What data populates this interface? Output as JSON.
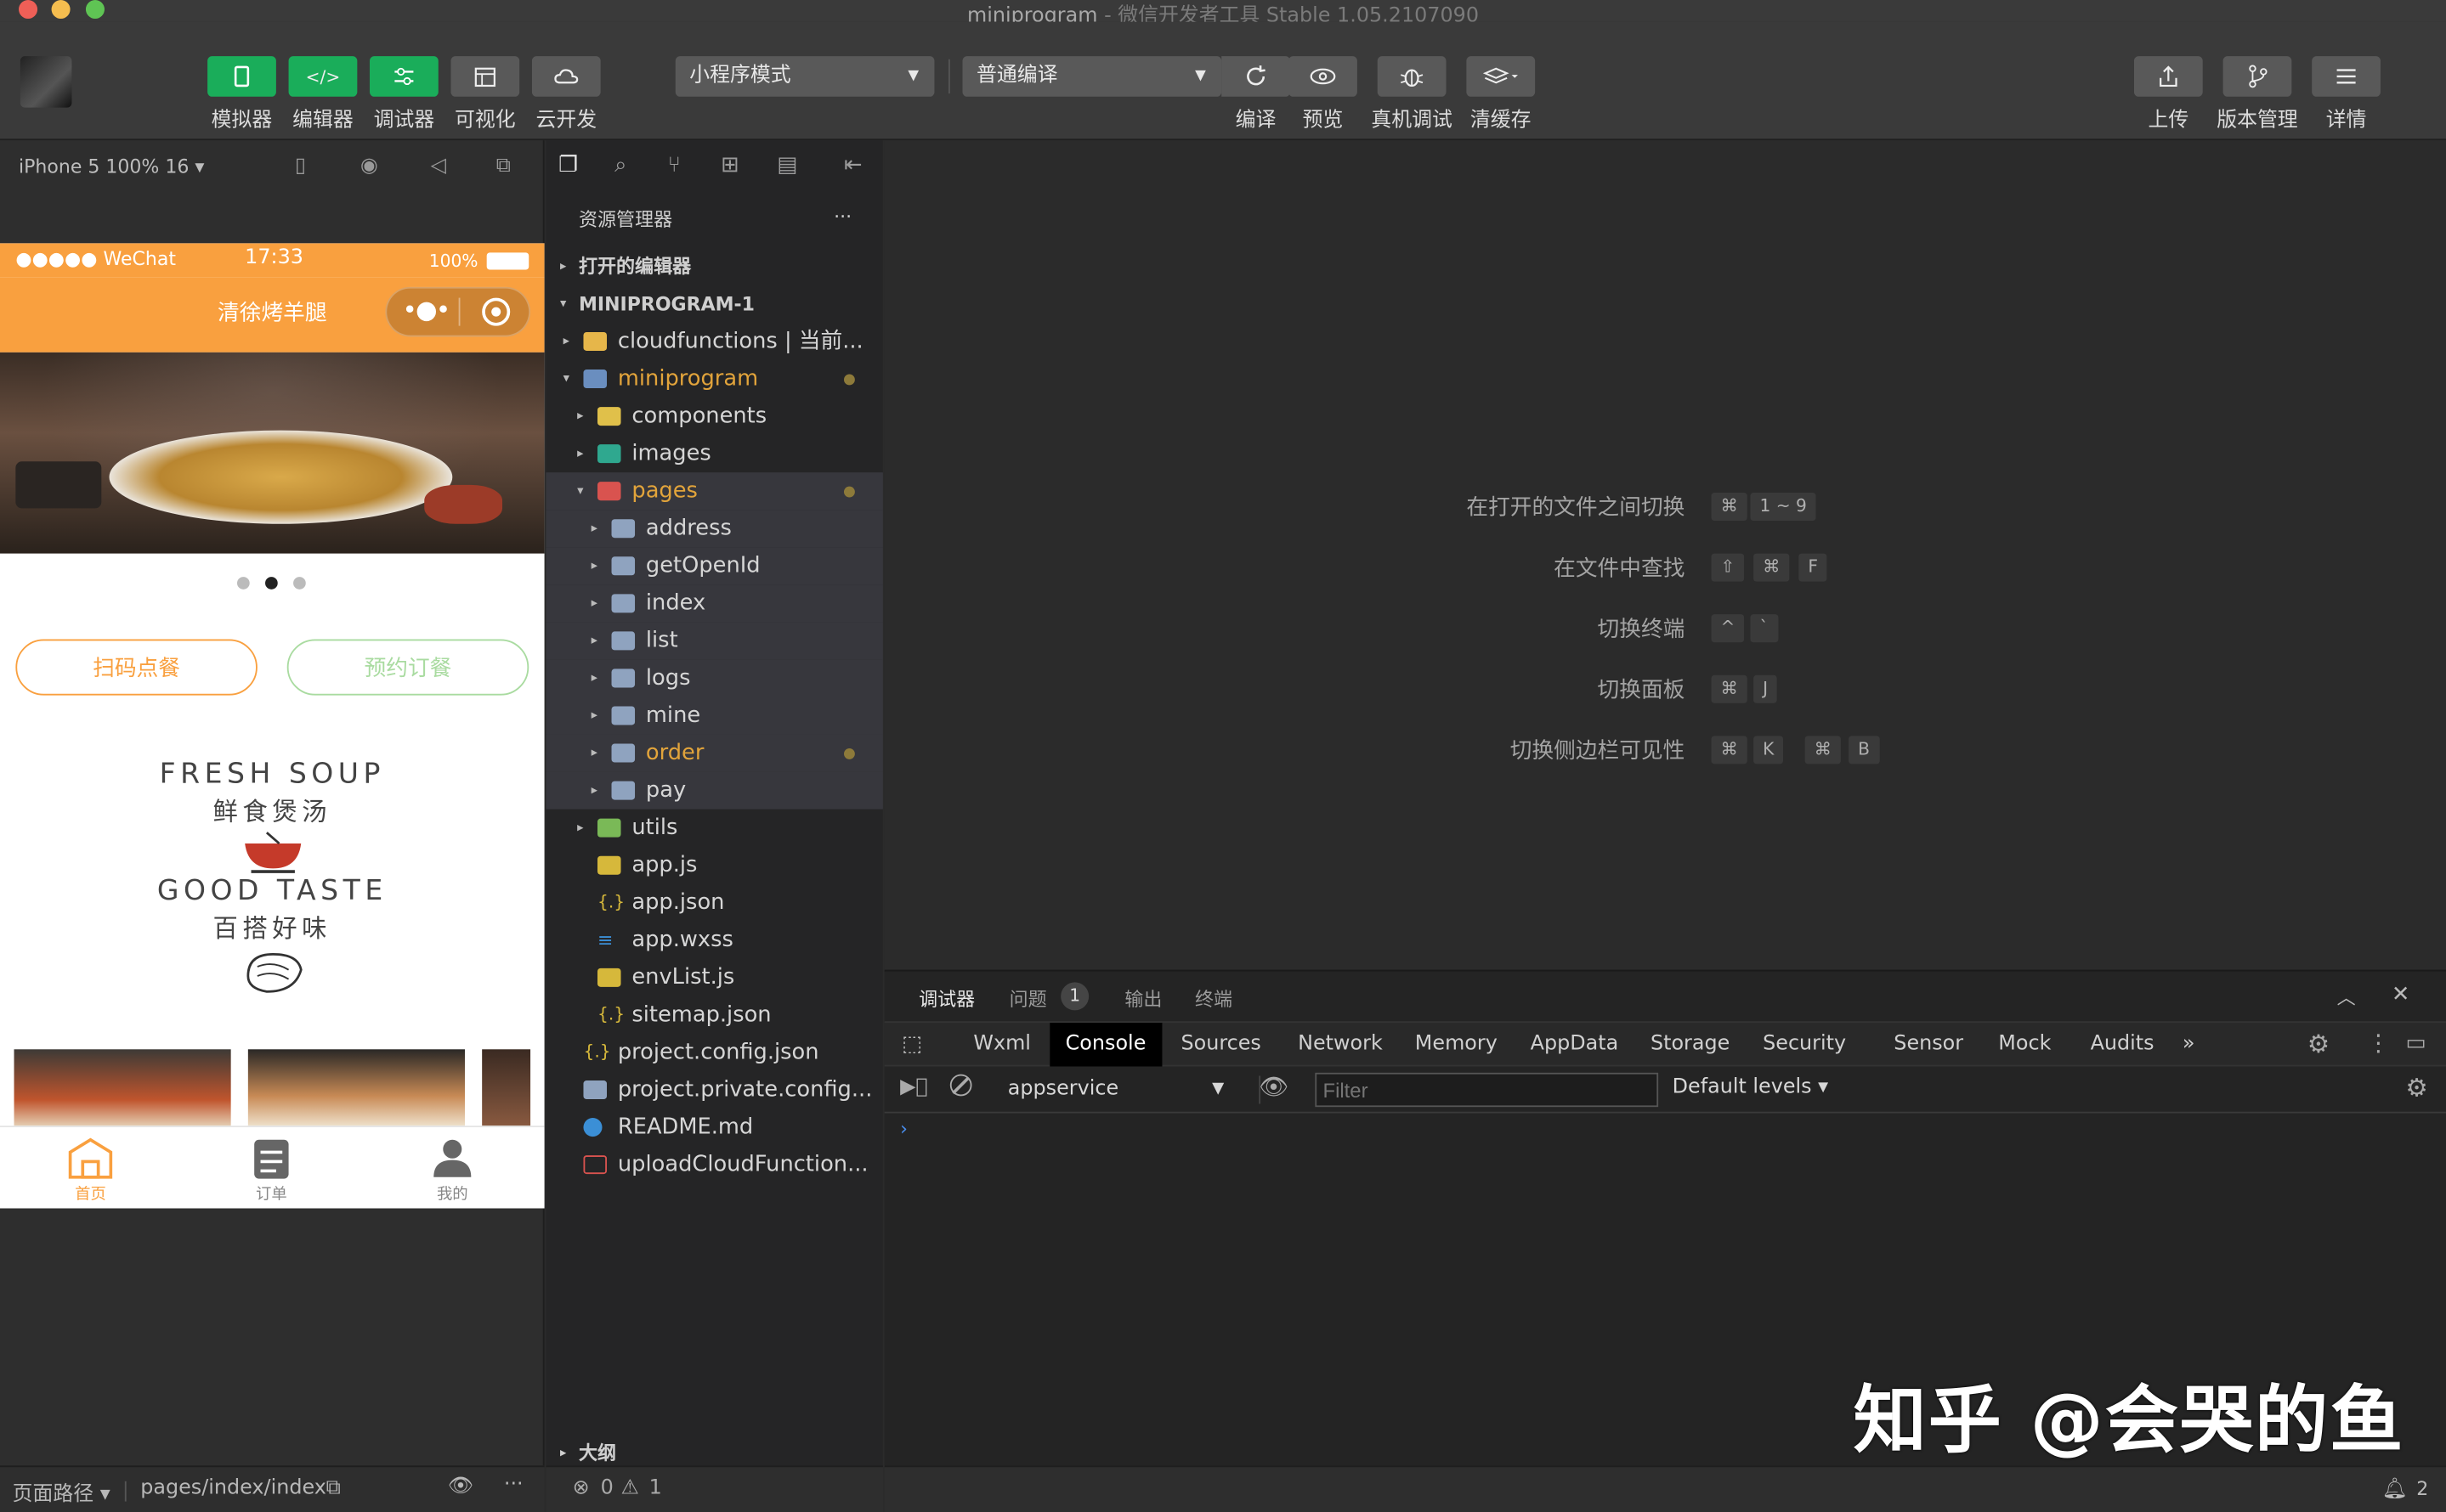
{
  "window": {
    "title": "miniprogram",
    "subtitle": "- 微信开发者工具 Stable 1.05.2107090"
  },
  "toolbar": {
    "left_buttons": [
      {
        "label": "模拟器",
        "icon": "phone-icon"
      },
      {
        "label": "编辑器",
        "icon": "code-icon"
      },
      {
        "label": "调试器",
        "icon": "debug-sliders-icon"
      },
      {
        "label": "可视化",
        "icon": "layout-icon"
      },
      {
        "label": "云开发",
        "icon": "cloud-icon"
      }
    ],
    "mode_select": "小程序模式",
    "compile_select": "普通编译",
    "mid_buttons": [
      {
        "label": "编译",
        "icon": "refresh-icon"
      },
      {
        "label": "预览",
        "icon": "eye-icon"
      },
      {
        "label": "真机调试",
        "icon": "bug-icon"
      },
      {
        "label": "清缓存",
        "icon": "layers-icon"
      }
    ],
    "right_buttons": [
      {
        "label": "上传",
        "icon": "upload-icon"
      },
      {
        "label": "版本管理",
        "icon": "branch-icon"
      },
      {
        "label": "详情",
        "icon": "menu-icon"
      }
    ]
  },
  "simulator": {
    "device": "iPhone 5 100% 16 ▾",
    "status_carrier": "●●●●● WeChat",
    "status_time": "17:33",
    "status_battery": "100%",
    "nav_title": "清徐烤羊腿",
    "btn_scan": "扫码点餐",
    "btn_reserve": "预约订餐",
    "card_lines": [
      "FRESH SOUP",
      "鲜食煲汤",
      "GOOD TASTE",
      "百搭好味"
    ],
    "tabs": [
      {
        "label": "首页",
        "icon": "home-icon"
      },
      {
        "label": "订单",
        "icon": "order-icon"
      },
      {
        "label": "我的",
        "icon": "user-icon"
      }
    ],
    "footer_path_label": "页面路径 ▾",
    "footer_path": "pages/index/index"
  },
  "explorer": {
    "title": "资源管理器",
    "more": "···",
    "open_editors": "打开的编辑器",
    "project": "MINIPROGRAM-1",
    "outline": "大纲",
    "tree": [
      {
        "label": "cloudfunctions | 当前...",
        "depth": 0,
        "arrow": "▸"
      },
      {
        "label": "miniprogram",
        "depth": 0,
        "arrow": "▾"
      },
      {
        "label": "components",
        "depth": 1,
        "arrow": "▸"
      },
      {
        "label": "images",
        "depth": 1,
        "arrow": "▸"
      },
      {
        "label": "pages",
        "depth": 1,
        "arrow": "▾"
      },
      {
        "label": "address",
        "depth": 2,
        "arrow": "▸"
      },
      {
        "label": "getOpenId",
        "depth": 2,
        "arrow": "▸"
      },
      {
        "label": "index",
        "depth": 2,
        "arrow": "▸"
      },
      {
        "label": "list",
        "depth": 2,
        "arrow": "▸"
      },
      {
        "label": "logs",
        "depth": 2,
        "arrow": "▸"
      },
      {
        "label": "mine",
        "depth": 2,
        "arrow": "▸"
      },
      {
        "label": "order",
        "depth": 2,
        "arrow": "▸"
      },
      {
        "label": "pay",
        "depth": 2,
        "arrow": "▸"
      },
      {
        "label": "utils",
        "depth": 1,
        "arrow": "▸"
      },
      {
        "label": "app.js",
        "depth": 1,
        "arrow": ""
      },
      {
        "label": "app.json",
        "depth": 1,
        "arrow": ""
      },
      {
        "label": "app.wxss",
        "depth": 1,
        "arrow": ""
      },
      {
        "label": "envList.js",
        "depth": 1,
        "arrow": ""
      },
      {
        "label": "sitemap.json",
        "depth": 1,
        "arrow": ""
      },
      {
        "label": "project.config.json",
        "depth": 0,
        "arrow": ""
      },
      {
        "label": "project.private.config...",
        "depth": 0,
        "arrow": ""
      },
      {
        "label": "README.md",
        "depth": 0,
        "arrow": ""
      },
      {
        "label": "uploadCloudFunction...",
        "depth": 0,
        "arrow": ""
      }
    ],
    "status_errors": "0",
    "status_warnings": "1"
  },
  "editor": {
    "shortcuts": [
      {
        "label": "在打开的文件之间切换",
        "keys": [
          "⌘",
          "1 ~ 9"
        ]
      },
      {
        "label": "在文件中查找",
        "keys": [
          "⇧",
          "⌘",
          "F"
        ]
      },
      {
        "label": "切换终端",
        "keys": [
          "^",
          "`"
        ]
      },
      {
        "label": "切换面板",
        "keys": [
          "⌘",
          "J"
        ]
      },
      {
        "label": "切换侧边栏可见性",
        "keys": [
          "⌘",
          "K",
          "⌘",
          "B"
        ]
      }
    ]
  },
  "debug": {
    "tabs": [
      "调试器",
      "问题",
      "输出",
      "终端"
    ],
    "problems_count": "1",
    "console_tabs": [
      "Wxml",
      "Console",
      "Sources",
      "Network",
      "Memory",
      "AppData",
      "Storage",
      "Security",
      "Sensor",
      "Mock",
      "Audits"
    ],
    "more_tabs": "»",
    "context": "appservice",
    "filter_placeholder": "Filter",
    "levels": "Default levels ▾",
    "prompt": "›",
    "notifications": "2"
  },
  "watermark": "知乎 @会哭的鱼",
  "colors": {
    "green_button": "#1aad5a",
    "phone_header": "#f9a03f",
    "modified_orange": "#e2a43b"
  }
}
